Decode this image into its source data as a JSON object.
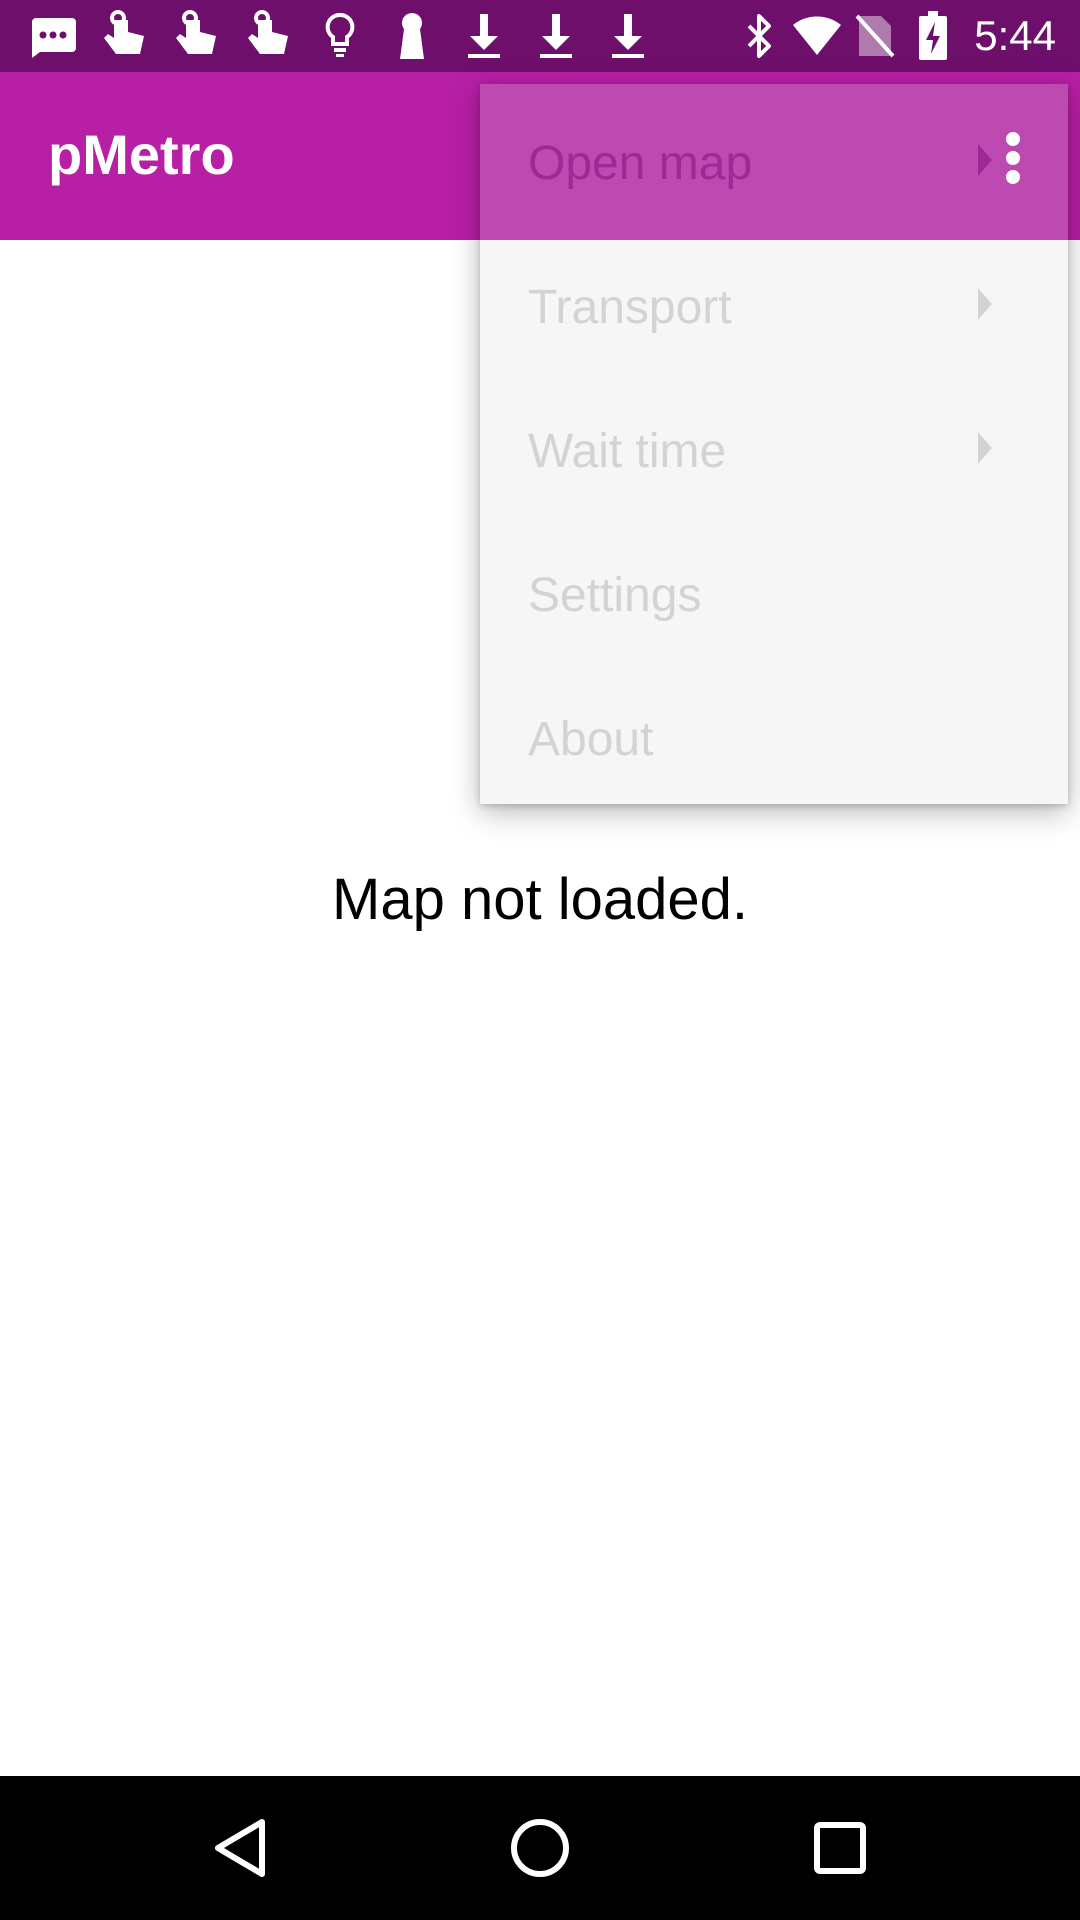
{
  "status_bar": {
    "time": "5:44",
    "left_icons": [
      "message-icon",
      "gesture-icon",
      "gesture-icon",
      "gesture-icon",
      "lightbulb-icon",
      "keyhole-icon",
      "download-icon",
      "download-icon",
      "download-icon"
    ],
    "right_icons": [
      "bluetooth-icon",
      "wifi-icon",
      "no-sim-icon",
      "battery-charging-icon"
    ]
  },
  "app_bar": {
    "title": "pMetro",
    "overflow_icon": "more-vert-icon"
  },
  "main": {
    "message": "Map not loaded."
  },
  "menu": {
    "items": [
      {
        "label": "Open map",
        "has_submenu": true,
        "highlighted": true
      },
      {
        "label": "Transport",
        "has_submenu": true,
        "highlighted": false
      },
      {
        "label": "Wait time",
        "has_submenu": true,
        "highlighted": false
      },
      {
        "label": "Settings",
        "has_submenu": false,
        "highlighted": false
      },
      {
        "label": "About",
        "has_submenu": false,
        "highlighted": false
      }
    ]
  },
  "nav_bar": {
    "buttons": [
      "back-icon",
      "home-icon",
      "recents-icon"
    ]
  },
  "colors": {
    "status_bar": "#6e0f6b",
    "app_bar": "#b71fa5",
    "menu_background": "#f6f6f6",
    "menu_highlight": "#bd4ab0",
    "menu_text_disabled": "#d3d3d3",
    "menu_text_active": "#a22796"
  }
}
